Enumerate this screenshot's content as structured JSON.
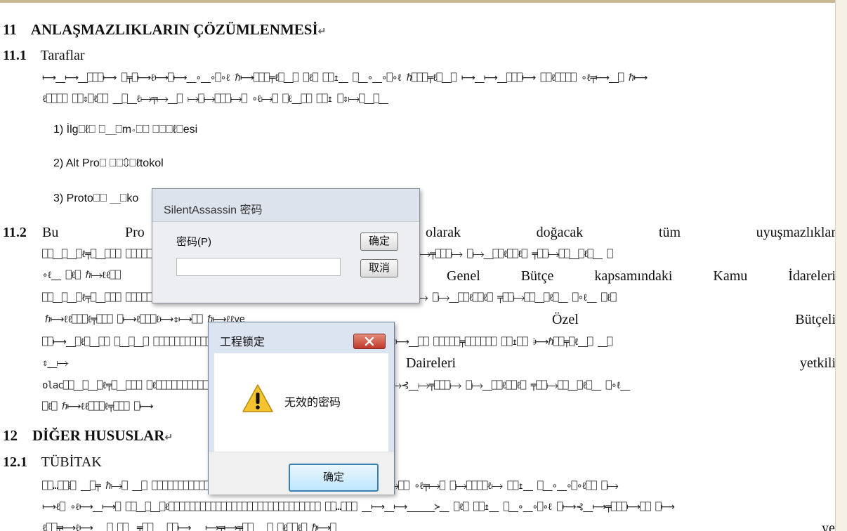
{
  "document": {
    "sec11": {
      "num": "11",
      "title": "ANLAŞMAZLIKLARIN ÇÖZÜMLENMESİ"
    },
    "sec11_1": {
      "num": "11.1",
      "title": "Taraflar"
    },
    "p11_1": [
      "⟼⎽⟼⎽⎕⎕⎕⟼ ⎕╤⎕⟼ℓ⟼⎕⟼⎽∘⎽∘⎕∘ℓ ℏ⟼⎕⎕⎕╤ℓ⎕⎽⎕ ⎕ℓ⎕ ⎕⎕↥⎽ ⎕⎽∘⎽∘⎕∘ℓ ℏ⎕⎕⎕╤ℓ⎕⎽⎕ ⟼⎽⟼⎽⎕⎕⎕⟼ ⎕⎕ℓ⎕⎕⎕⎕ ∘ℓ╤⟼⎽⎕ ℏ⟼",
      "ℓ⎕⎕⎕⎕ ⎕⎕⇕⎕ℓ⎕⎕ ⎽⎕⎽ℓ⟼╤⟼⎽⎕ ⟼⎕⟼⎕⎕⎕⟼⎕ ∘ℓ⟼⎕ ⎕ℓ⎽⎕⎕ ⎕⎕↥ ⎕⇕⟼⎕⎽⎕⎽"
    ],
    "list": [
      "1) İlg⎕ℓ⎕ ⎕⎽⎕m∘⎕⎕ ⎕⎕⎕ℓ⎕esi",
      "2) Alt Pro⎕ ⎕⎕⇕⎕ℓtokol",
      "3) Proto⎕⎕ ⎽⎕ko"
    ],
    "sec11_2": {
      "num": "11.2"
    },
    "p11_2": {
      "l1_bu": "Bu",
      "l1_pro": "Pro",
      "l1": [
        "olarak",
        "doğacak",
        "tüm",
        "uyuşmazlıklar"
      ],
      "l2": "⎕⎕⎽⎕⎽⎕ℓ╤⎕⎽⎕⎕⎕ ⎕⎕⎕⎕⎕⎕⎕⎕⎕⎕⎕⎕⎕⎕⎕⎕⎕⎕⎕⎕⎕⎕⎕⎕⎕⎕⎕⎕⎕⎕⎕⎕⎕⎕⎕ ⟼⎽⟼⎽⎕⟼╤⎕ ⎕⟼⊰⎽⟼╤⎕⎕⎕⟼ ⎕⟼⎽⎕⎕ℓ⎕⎕ℓ⎕ ╤⎕⎕⟼⎕⎕⎽⎕ℓ⎕⎽ ⎕",
      "l3_left": "∘ℓ⎽ ⎕ℓ⎕ ℏ⟼ℓℓ⎕⎕",
      "l3": [
        "Genel",
        "Bütçe",
        "kapsamındaki",
        "Kamu",
        "İdareleri"
      ],
      "l4": "⎕⎕⎽⎕⎽⎕ℓ╤⎕⎽⎕⎕⎕ ⎕⎕⎕⎕⎕⎕⎕⎕⎕⎕⎕⎕⎕⎕⎕⎕⎕⎕⎕⎕⎕⎕⎕⎕⎕⎕⎕⎕⎕⎕⎕⎕⎕⎕⎕ ⟼⟼╤⎕ ⎕⟼⊰⎽⟼╤⎕⎕⎕⟼ ⎕⟼⎽⎕⎕ℓ⎕⎕ℓ⎕ ╤⎕⎕⟼⎕⎕⎽⎕ℓ⎕⎽ ⎕∘ℓ⎽ ⎕ℓ⎕",
      "l5_left": "ℏ⟼ℓℓ⎕⎕⎕ℓ╤⎕⎕⎕ ⎕⟼ℓ⎕⎕⎕ℓ⟼⇕⟼⎕⎕ ℏ⟼ℓℓve",
      "l5": [
        "Özel",
        "Bütçeli"
      ],
      "l6": "⎕⎕⟼⎽⎕ℓ⎕⎽⎕⎕ ⎕⎽⎕⎽⎕ ⎕⎕⎕⎕⎕⎕⎕⎕⎕⎕⎕⎕⎕⎕⎕⎕⎕⎕⎕⎕⎕⎕⎕⎕⎕⎕⎕ ⎽⎕⎕ ⎽⎕⎽⎕╤⟼⎕ℓ⎕⎕ℓ⟼⎽⎕⎕ ⎕⎕⎕⎕⎕╤⎕⎕⎕⎕⎕⎕ ⎕⎕↥⎕⎕ ⁞⟼ℏ⎕⎕╤⎕ℓ⎽⎕ ⎽⎕",
      "l7_left": "⇕⎽⟼",
      "l7": [
        "Daireleri",
        "yetkili"
      ],
      "l8": "olac⎕⎕⎽⎕⎽⎕ℓ╤⎕⎽⎕⎕⎕ ⎕ℓ⎕⎕⎕⎕⎕⎕⎕⎕⎕⎕⎕⎕⎕⎕⎕⎕⎕⎕⎕⎕⎕⎕⎕⎕⎕⎕⎕⎕⎕ ⟼⎽⟼⎽⎕⟼╤⎕ ⎕⟼⊰⎽⟼╤⎕⎕⎕⟼ ⎕⟼⎽⎕⎕ℓ⎕⎕ℓ⎕ ╤⎕⎕⟼⎕⎕⎽⎕ℓ⎕⎽ ⎕∘ℓ⎽",
      "l9": "⎕ℓ⎕ ℏ⟼ℓℓ⎕⎕⎕ℓ╤⎕⎕⎕ ⎕⟼"
    },
    "sec12": {
      "num": "12",
      "title": "DİĞER HUSUSLAR"
    },
    "sec12_1": {
      "num": "12.1",
      "title": "TÜBİTAK"
    },
    "p12_1": [
      "⎕⎕…⎕⎕⁞⎕ ⎽⎕╤ ℏ⟼⎕ ⎽⎕ ⎕⎕⎕⎕⎕⎕⎕⎕⎕⎕⎕⎕⎕⎕⎕⎕⎕⎕⎕⎕⎕⎕⎕⎕⎕⎕⎕ ⎽⎕⎕⎽⎕⎕⟼ ⎕⎕⎽⎽⎕⟼⎕⎕ ∘ℓ╤⟼⎕ ⎕⟼⎕⎕⎕⎕ℓ⟼ ⎕⎕↥⎽ ⎕⎽∘⎽∘⎕∘ℓ⎕⎕ ⎕⟼",
      "⟼ℓ⎕ ∘ℓ⟼⎽⟼⎕ ⎕⎕⎽⎕⎽⎕ℓ⎕⎕⎕⎕⎕⎕⎕⎕⎕⎕⎕⎕⎕⎕⎕⎕⎕⎕⎕⎕⎕⎕⎕⎕⎕⎕⎕⎕⎕ ⎕⎕…⎕⎕⎕ ⎽⟼⎽⟼⎽⎽⎽≻⎽ ⎕ℓ⎕ ⎕⎕↥⎽ ⎕⎽∘⎽∘⎕∘ℓ ⎕⟼⊰⎽⟼╤⎕⎕⎕⟼⎕⎕ ⎕⟼",
      "ℓ⎕⎕╤⟼ℓ⟼ ⎽⎕ ⎕⎕⎽╤⎕⎕ ⎽⎕⎕⟼ ⎽⟼╤⟼╤⎕⎕ ⎽⎕ ⎕ℓ⎕⎕ℓ⎕ ℏ⟼⎕"
    ],
    "last_tail": "ye",
    "paragraph_mark": "↵"
  },
  "password_dialog": {
    "title": "SilentAssassin 密码",
    "label": "密码(P)",
    "value": "",
    "ok_label": "确定",
    "cancel_label": "取消"
  },
  "error_dialog": {
    "title": "工程锁定",
    "message": "无效的密码",
    "ok_label": "确定",
    "close_icon": "close-icon",
    "warning_icon": "warning-icon"
  }
}
